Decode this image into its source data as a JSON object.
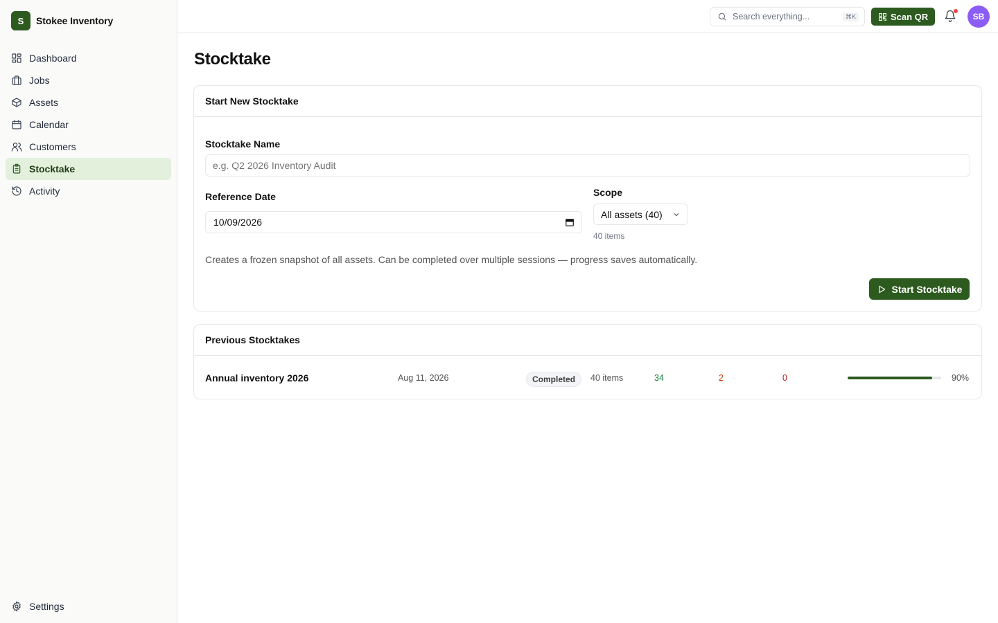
{
  "brand": {
    "logo_letter": "S",
    "name": "Stokee Inventory"
  },
  "sidebar": {
    "items": [
      {
        "label": "Dashboard",
        "icon": "dashboard-icon",
        "active": false
      },
      {
        "label": "Jobs",
        "icon": "briefcase-icon",
        "active": false
      },
      {
        "label": "Assets",
        "icon": "box-icon",
        "active": false
      },
      {
        "label": "Calendar",
        "icon": "calendar-icon",
        "active": false
      },
      {
        "label": "Customers",
        "icon": "users-icon",
        "active": false
      },
      {
        "label": "Stocktake",
        "icon": "clipboard-icon",
        "active": true
      },
      {
        "label": "Activity",
        "icon": "history-icon",
        "active": false
      }
    ],
    "settings_label": "Settings"
  },
  "topbar": {
    "search_placeholder": "Search everything...",
    "search_shortcut": "⌘K",
    "scan_label": "Scan QR",
    "has_notifications": true,
    "avatar_initials": "SB"
  },
  "page": {
    "title": "Stocktake"
  },
  "new_stocktake": {
    "header": "Start New Stocktake",
    "name_label": "Stocktake Name",
    "name_placeholder": "e.g. Q2 2026 Inventory Audit",
    "date_label": "Reference Date",
    "date_value": "10/09/2026",
    "scope_label": "Scope",
    "scope_value": "All assets (40)",
    "scope_hint": "40 items",
    "description": "Creates a frozen snapshot of all assets. Can be completed over multiple sessions — progress saves automatically.",
    "start_label": "Start Stocktake"
  },
  "previous": {
    "header": "Previous Stocktakes",
    "rows": [
      {
        "name": "Annual inventory 2026",
        "date": "Aug 11, 2026",
        "status": "Completed",
        "items": "40 items",
        "found": "34",
        "missing": "2",
        "extra": "0",
        "progress": 0.9,
        "progress_label": "90%"
      }
    ]
  },
  "colors": {
    "brand": "#2d5a1f",
    "active_nav_bg": "#e2f0dc",
    "found": "#15803d",
    "missing": "#c2410c",
    "extra": "#b91c1c",
    "avatar": "#8b5cf6",
    "notification_dot": "#ef4444"
  }
}
